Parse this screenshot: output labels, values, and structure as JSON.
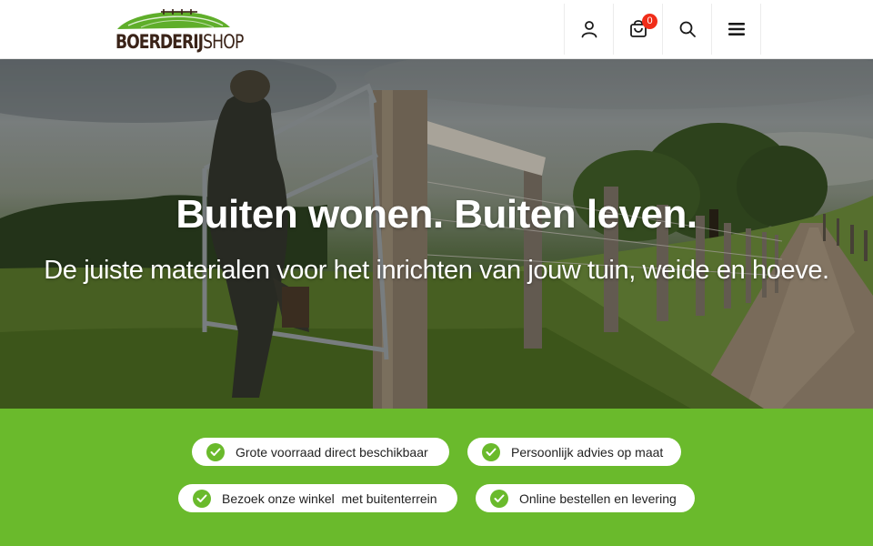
{
  "brand": {
    "logo_bold": "BOERDERIJ",
    "logo_light": "SHOP",
    "colors": {
      "brown": "#3a2318",
      "green": "#6aba2c",
      "badge": "#f02d19"
    }
  },
  "header": {
    "icons": [
      "account-icon",
      "cart-icon",
      "search-icon",
      "menu-icon"
    ],
    "cart_count": "0"
  },
  "hero": {
    "title": "Buiten wonen. Buiten leven.",
    "subtitle": "De juiste materialen voor het inrichten van jouw tuin, weide en hoeve."
  },
  "usps": [
    "Grote voorraad direct beschikbaar",
    "Persoonlijk advies op maat",
    "Bezoek onze winkel  met buitenterrein",
    "Online bestellen en levering"
  ]
}
